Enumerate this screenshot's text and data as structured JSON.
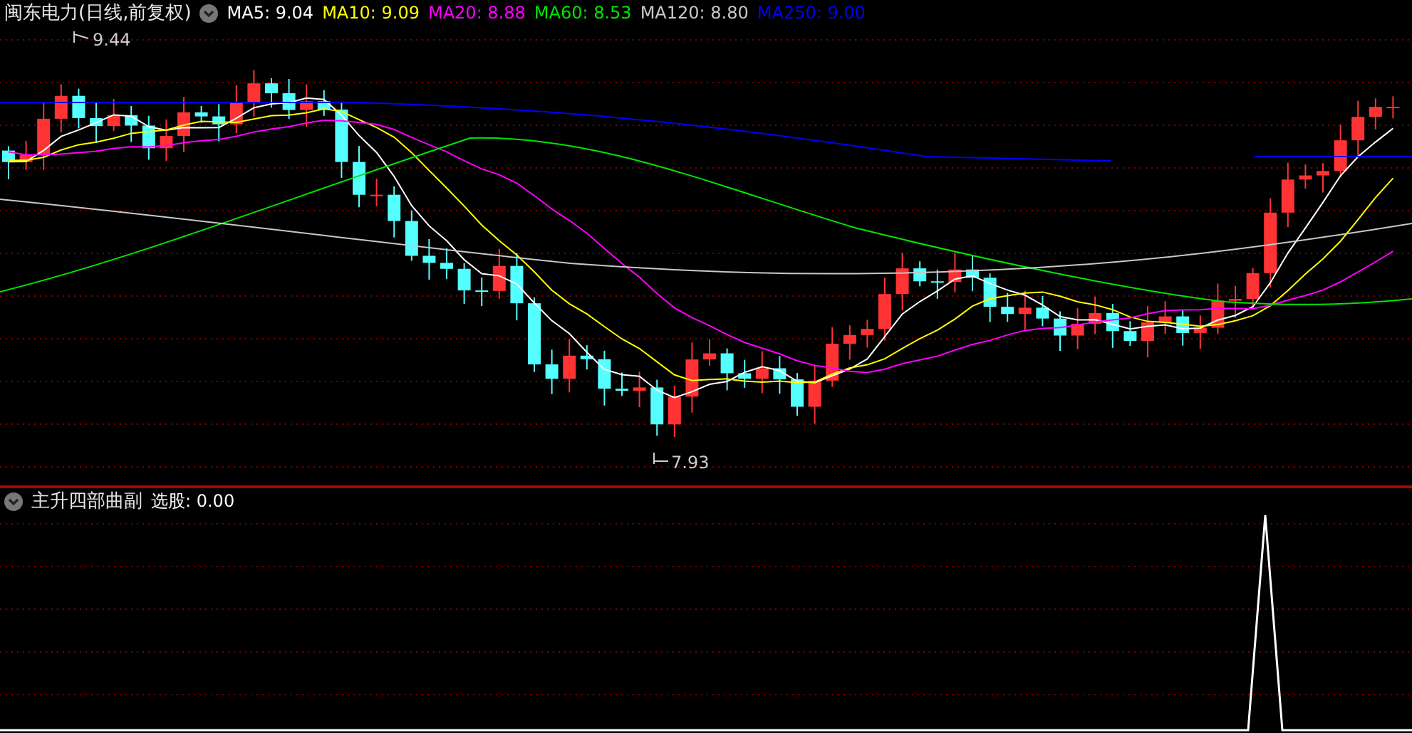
{
  "title": "闽东电力(日线,前复权)",
  "legend": [
    {
      "label": "MA5: 9.04",
      "color": "#ffffff"
    },
    {
      "label": "MA10: 9.09",
      "color": "#ffff00"
    },
    {
      "label": "MA20: 8.88",
      "color": "#ff00ff"
    },
    {
      "label": "MA60: 8.53",
      "color": "#00e600"
    },
    {
      "label": "MA120: 8.80",
      "color": "#c8c8c8"
    },
    {
      "label": "MA250: 9.00",
      "color": "#0000ff"
    }
  ],
  "price_chart": {
    "high_label": "9.44",
    "low_label": "7.93"
  },
  "indicator": {
    "name": "主升四部曲副",
    "reading": "选股: 0.00"
  }
}
